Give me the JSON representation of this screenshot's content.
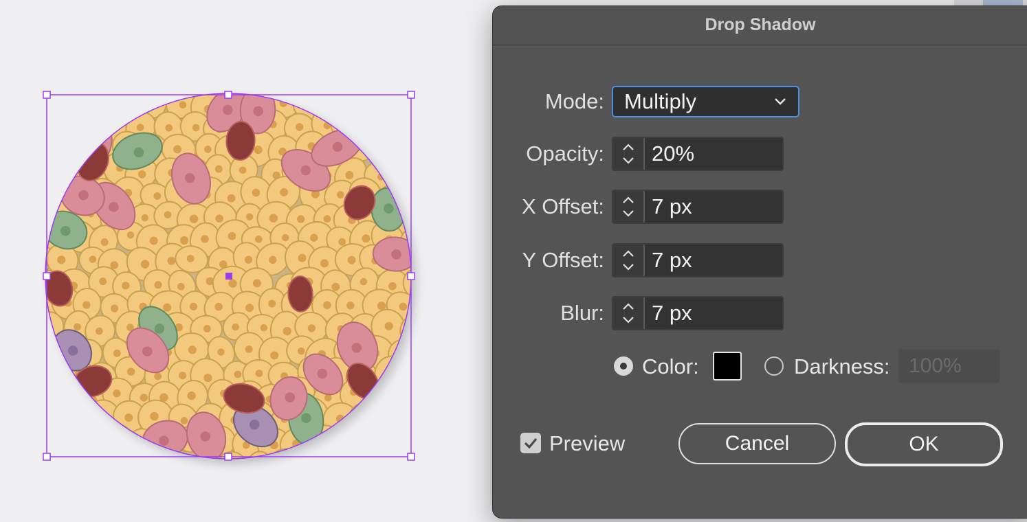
{
  "dialog": {
    "title": "Drop Shadow",
    "mode": {
      "label": "Mode:",
      "value": "Multiply"
    },
    "opacity": {
      "label": "Opacity:",
      "value": "20%"
    },
    "x_offset": {
      "label": "X Offset:",
      "value": "7 px"
    },
    "y_offset": {
      "label": "Y Offset:",
      "value": "7 px"
    },
    "blur": {
      "label": "Blur:",
      "value": "7 px"
    },
    "color": {
      "label": "Color:",
      "selected": true,
      "swatch": "#000000"
    },
    "darkness": {
      "label": "Darkness:",
      "selected": false,
      "value": "100%"
    },
    "preview": {
      "label": "Preview",
      "checked": true
    },
    "cancel_label": "Cancel",
    "ok_label": "OK"
  },
  "artwork": {
    "name": "cell-tissue-circle",
    "selection_color": "#9b3cf0",
    "colors": {
      "cell_yellow": "#f3c97e",
      "cell_edge": "#c9a24f",
      "nucleus": "#d9a04e",
      "pink": "#d98d98",
      "dark_red": "#8c3a38",
      "green": "#8fb18b",
      "purple": "#a88fb4"
    }
  }
}
